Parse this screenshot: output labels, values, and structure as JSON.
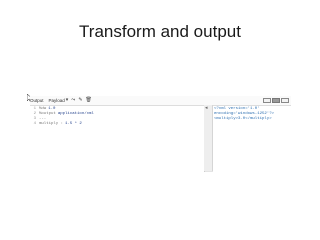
{
  "slide": {
    "title": "Transform and output"
  },
  "toolbar": {
    "output_label": "Output",
    "payload_label": "Payload",
    "icons": [
      "chevron-down-icon",
      "share-icon",
      "pencil-icon",
      "trash-icon"
    ]
  },
  "editor": {
    "lines": [
      {
        "num": "1",
        "keyword": "%dw",
        "value": "1.0"
      },
      {
        "num": "2",
        "keyword": "%output",
        "value": "application/xml"
      },
      {
        "num": "3",
        "keyword": "---",
        "value": ""
      },
      {
        "num": "4",
        "keyword": "multiply :",
        "value": "1.5 * 2"
      }
    ]
  },
  "output": {
    "lines": [
      "<?xml version='1.0'",
      "encoding='windows-1252'?>",
      "<multiply>3.0</multiply>"
    ]
  },
  "colors": {
    "keyword": "#777777",
    "value": "#1f3e8a",
    "xml": "#2a6db0"
  }
}
